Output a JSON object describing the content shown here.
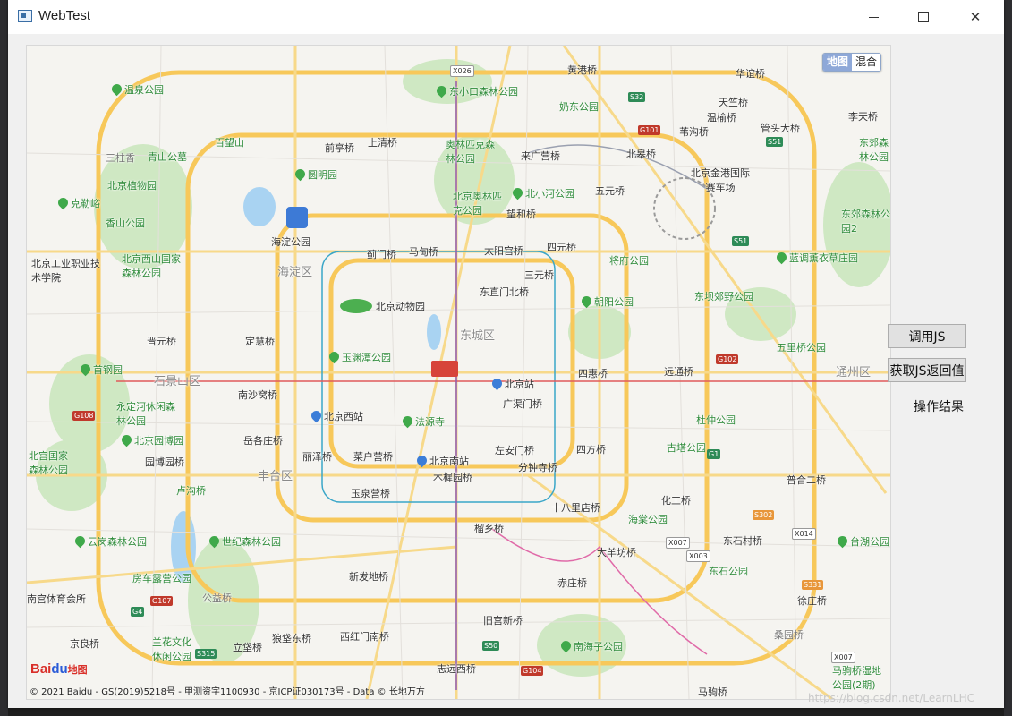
{
  "window": {
    "title": "WebTest",
    "buttons": {
      "minimize": "—",
      "maximize": "☐",
      "close": "✕"
    }
  },
  "map": {
    "map_type": {
      "map": "地图",
      "hybrid": "混合",
      "selected": "地图"
    },
    "logo": {
      "text": "Bai",
      "paw": "du",
      "suffix": "地图"
    },
    "copyright": "© 2021 Baidu - GS(2019)5218号 - 甲测资字1100930 - 京ICP证030173号 - Data © 长地万方",
    "districts": [
      "海淀区",
      "东城区",
      "石景山区",
      "丰台区",
      "通州区"
    ],
    "places": [
      {
        "name": "温泉公园",
        "kind": "park"
      },
      {
        "name": "东小口森林公园",
        "kind": "park"
      },
      {
        "name": "黄港桥",
        "kind": "road"
      },
      {
        "name": "华谊桥",
        "kind": "road"
      },
      {
        "name": "奶东公园",
        "kind": "park"
      },
      {
        "name": "天竺桥",
        "kind": "road"
      },
      {
        "name": "温榆桥",
        "kind": "road"
      },
      {
        "name": "李天桥",
        "kind": "road"
      },
      {
        "name": "百望山",
        "kind": "park"
      },
      {
        "name": "前亭桥",
        "kind": "road"
      },
      {
        "name": "上清桥",
        "kind": "road"
      },
      {
        "name": "奥林匹克森林公园",
        "kind": "park"
      },
      {
        "name": "来广营桥",
        "kind": "road"
      },
      {
        "name": "苇沟桥",
        "kind": "road"
      },
      {
        "name": "管头大桥",
        "kind": "road"
      },
      {
        "name": "青山公墓",
        "kind": "park"
      },
      {
        "name": "三柱香",
        "kind": "place"
      },
      {
        "name": "圆明园",
        "kind": "park"
      },
      {
        "name": "北皋桥",
        "kind": "road"
      },
      {
        "name": "北京植物园",
        "kind": "park"
      },
      {
        "name": "北京金港国际赛车场",
        "kind": "poi"
      },
      {
        "name": "东郊森林公园",
        "kind": "park"
      },
      {
        "name": "克勒峪",
        "kind": "park"
      },
      {
        "name": "北京奥林匹克公园",
        "kind": "park"
      },
      {
        "name": "北小河公园",
        "kind": "park"
      },
      {
        "name": "五元桥",
        "kind": "road"
      },
      {
        "name": "香山公园",
        "kind": "park"
      },
      {
        "name": "望和桥",
        "kind": "road"
      },
      {
        "name": "海淀公园",
        "kind": "park"
      },
      {
        "name": "东郊森林公园2",
        "kind": "park"
      },
      {
        "name": "北京西山国家森林公园",
        "kind": "park"
      },
      {
        "name": "蓟门桥",
        "kind": "road"
      },
      {
        "name": "马甸桥",
        "kind": "road"
      },
      {
        "name": "太阳宫桥",
        "kind": "road"
      },
      {
        "name": "四元桥",
        "kind": "road"
      },
      {
        "name": "将府公园",
        "kind": "park"
      },
      {
        "name": "蓝调薰衣草庄园",
        "kind": "park"
      },
      {
        "name": "北京工业职业技术学院",
        "kind": "poi"
      },
      {
        "name": "三元桥",
        "kind": "road"
      },
      {
        "name": "东坝郊野公园",
        "kind": "park"
      },
      {
        "name": "东直门北桥",
        "kind": "road"
      },
      {
        "name": "朝阳公园",
        "kind": "park"
      },
      {
        "name": "北京动物园",
        "kind": "poi"
      },
      {
        "name": "晋元桥",
        "kind": "road"
      },
      {
        "name": "定慧桥",
        "kind": "road"
      },
      {
        "name": "五里桥公园",
        "kind": "park"
      },
      {
        "name": "玉渊潭公园",
        "kind": "park"
      },
      {
        "name": "首钢园",
        "kind": "park"
      },
      {
        "name": "北京站",
        "kind": "station"
      },
      {
        "name": "四惠桥",
        "kind": "road"
      },
      {
        "name": "远通桥",
        "kind": "road"
      },
      {
        "name": "南沙窝桥",
        "kind": "road"
      },
      {
        "name": "永定河休闲森林公园",
        "kind": "park"
      },
      {
        "name": "北京西站",
        "kind": "station"
      },
      {
        "name": "广渠门桥",
        "kind": "road"
      },
      {
        "name": "杜仲公园",
        "kind": "park"
      },
      {
        "name": "法源寺",
        "kind": "park"
      },
      {
        "name": "北京园博园",
        "kind": "park"
      },
      {
        "name": "岳各庄桥",
        "kind": "road"
      },
      {
        "name": "北宫国家森林公园",
        "kind": "park"
      },
      {
        "name": "丽泽桥",
        "kind": "road"
      },
      {
        "name": "菜户营桥",
        "kind": "road"
      },
      {
        "name": "北京南站",
        "kind": "station"
      },
      {
        "name": "左安门桥",
        "kind": "road"
      },
      {
        "name": "四方桥",
        "kind": "road"
      },
      {
        "name": "古塔公园",
        "kind": "park"
      },
      {
        "name": "园博园桥",
        "kind": "road"
      },
      {
        "name": "木樨园桥",
        "kind": "road"
      },
      {
        "name": "分钟寺桥",
        "kind": "road"
      },
      {
        "name": "普合二桥",
        "kind": "road"
      },
      {
        "name": "卢沟桥",
        "kind": "park"
      },
      {
        "name": "玉泉营桥",
        "kind": "road"
      },
      {
        "name": "化工桥",
        "kind": "road"
      },
      {
        "name": "十八里店桥",
        "kind": "road"
      },
      {
        "name": "海棠公园",
        "kind": "park"
      },
      {
        "name": "榴乡桥",
        "kind": "road"
      },
      {
        "name": "云岗森林公园",
        "kind": "park"
      },
      {
        "name": "世纪森林公园",
        "kind": "park"
      },
      {
        "name": "大羊坊桥",
        "kind": "road"
      },
      {
        "name": "东石村桥",
        "kind": "road"
      },
      {
        "name": "台湖公园",
        "kind": "park"
      },
      {
        "name": "东石公园",
        "kind": "park"
      },
      {
        "name": "房车露营公园",
        "kind": "park"
      },
      {
        "name": "新发地桥",
        "kind": "road"
      },
      {
        "name": "南宫体育会所",
        "kind": "poi"
      },
      {
        "name": "赤庄桥",
        "kind": "road"
      },
      {
        "name": "徐庄桥",
        "kind": "road"
      },
      {
        "name": "公益桥",
        "kind": "road"
      },
      {
        "name": "旧宫新桥",
        "kind": "road"
      },
      {
        "name": "兰花文化休闲公园",
        "kind": "park"
      },
      {
        "name": "京良桥",
        "kind": "road"
      },
      {
        "name": "狼垡东桥",
        "kind": "road"
      },
      {
        "name": "西红门南桥",
        "kind": "road"
      },
      {
        "name": "南海子公园",
        "kind": "park"
      },
      {
        "name": "立垡桥",
        "kind": "road"
      },
      {
        "name": "桑园桥",
        "kind": "road"
      },
      {
        "name": "志远西桥",
        "kind": "road"
      },
      {
        "name": "马驹桥湿地公园(2期)",
        "kind": "park"
      },
      {
        "name": "马驹桥",
        "kind": "road"
      }
    ],
    "shields": [
      {
        "text": "X026"
      },
      {
        "text": "S32"
      },
      {
        "text": "G101"
      },
      {
        "text": "S51"
      },
      {
        "text": "S51"
      },
      {
        "text": "G102"
      },
      {
        "text": "G1"
      },
      {
        "text": "G108"
      },
      {
        "text": "S302"
      },
      {
        "text": "X014"
      },
      {
        "text": "X007"
      },
      {
        "text": "X003"
      },
      {
        "text": "S331"
      },
      {
        "text": "G107"
      },
      {
        "text": "G4"
      },
      {
        "text": "S315"
      },
      {
        "text": "S50"
      },
      {
        "text": "G104"
      },
      {
        "text": "X007"
      }
    ]
  },
  "panel": {
    "call_js_button": "调用JS",
    "get_js_return_button": "获取JS返回值",
    "result_label": "操作结果"
  },
  "watermark": "https://blog.csdn.net/LearnLHC"
}
